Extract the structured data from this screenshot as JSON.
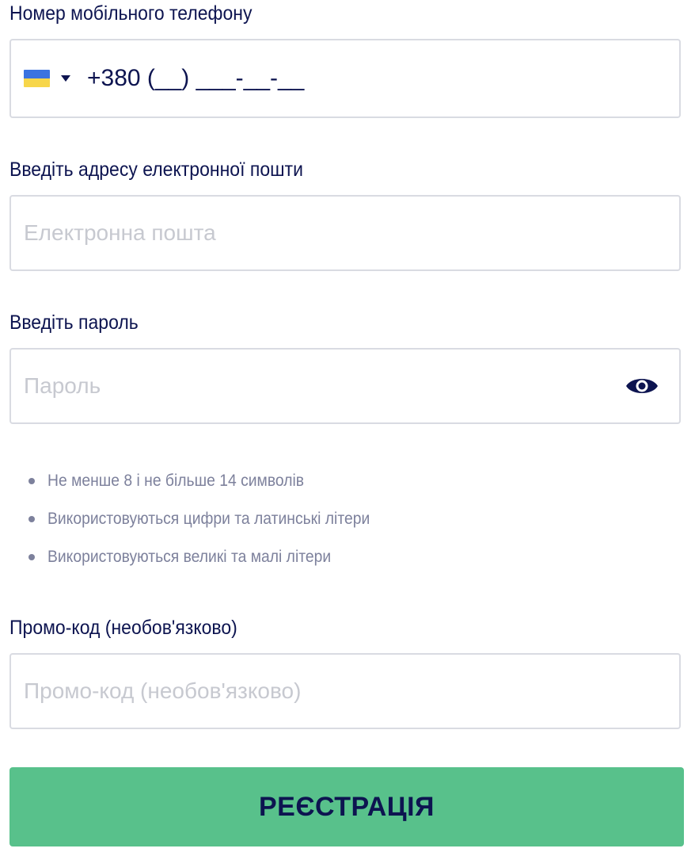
{
  "phone": {
    "label": "Номер мобільного телефону",
    "country_flag": "ukraine-flag-icon",
    "value": "+380 (__) ___-__-__"
  },
  "email": {
    "label": "Введіть адресу електронної пошти",
    "placeholder": "Електронна пошта",
    "value": ""
  },
  "password": {
    "label": "Введіть пароль",
    "placeholder": "Пароль",
    "value": "",
    "toggle_icon": "eye-icon"
  },
  "password_rules": [
    "Не менше 8 і не більше 14 символів",
    "Використовуються цифри та латинські літери",
    "Використовуються великі та малі літери"
  ],
  "promo": {
    "label": "Промо-код (необов'язково)",
    "placeholder": "Промо-код (необов'язково)",
    "value": ""
  },
  "submit": {
    "label": "РЕЄСТРАЦІЯ"
  },
  "colors": {
    "text_primary": "#0d1450",
    "text_muted": "#7d819c",
    "placeholder": "#c7c9d0",
    "border": "#d9dbe2",
    "button_bg": "#58c18b",
    "flag_blue": "#3b73e0",
    "flag_yellow": "#f7d64a"
  }
}
